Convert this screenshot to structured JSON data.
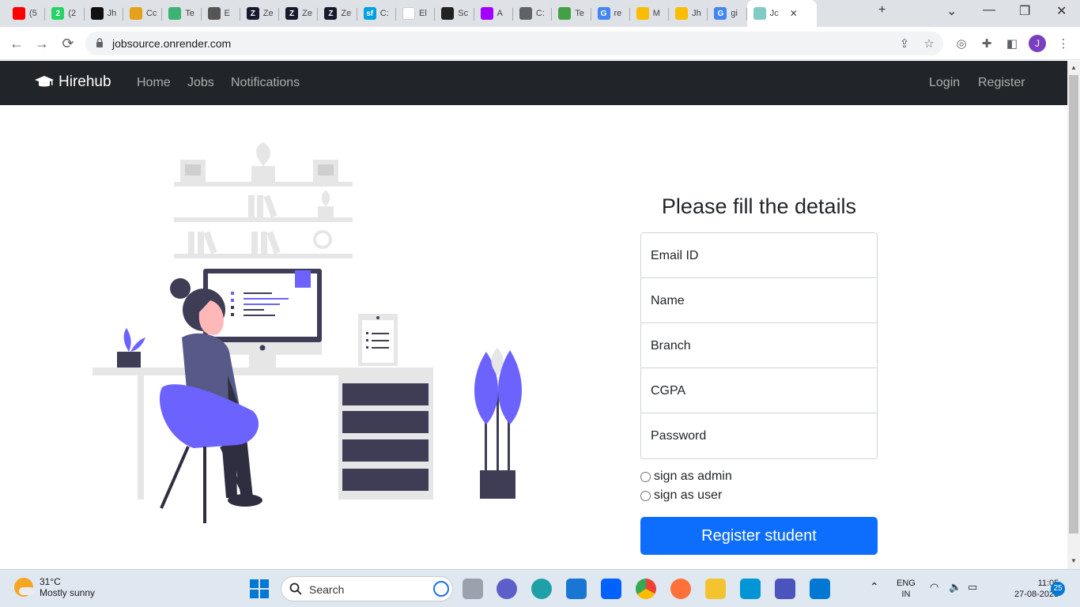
{
  "browser": {
    "tabs": [
      {
        "icon": "youtube-icon",
        "label": "(5",
        "color": "#ff0000"
      },
      {
        "icon": "whatsapp-icon",
        "label": "(2",
        "color": "#25d366",
        "glyph": "2"
      },
      {
        "icon": "github-icon",
        "label": "Jh",
        "color": "#111111"
      },
      {
        "icon": "codechef-icon",
        "label": "Cc",
        "color": "#e4a11b"
      },
      {
        "icon": "testgorilla-icon",
        "label": "Te",
        "color": "#3cb371"
      },
      {
        "icon": "ship-icon",
        "label": "E",
        "color": "#555555"
      },
      {
        "icon": "zepto-icon",
        "label": "Ze",
        "color": "#1a1a2e",
        "glyph": "Z"
      },
      {
        "icon": "zepto-icon",
        "label": "Ze",
        "color": "#1a1a2e",
        "glyph": "Z"
      },
      {
        "icon": "zepto-icon",
        "label": "Ze",
        "color": "#1a1a2e",
        "glyph": "Z"
      },
      {
        "icon": "salesforce-icon",
        "label": "C:",
        "color": "#00a1e0",
        "glyph": "sf"
      },
      {
        "icon": "blank-page-icon",
        "label": "El",
        "color": "#ffffff"
      },
      {
        "icon": "stack-icon",
        "label": "Sc",
        "color": "#222222"
      },
      {
        "icon": "arrow-icon",
        "label": "A",
        "color": "#a100ff"
      },
      {
        "icon": "globe-icon",
        "label": "C:",
        "color": "#5f6368"
      },
      {
        "icon": "leaf-icon",
        "label": "Te",
        "color": "#43a047"
      },
      {
        "icon": "google-icon",
        "label": "re",
        "color": "#4285f4",
        "glyph": "G"
      },
      {
        "icon": "drive-icon",
        "label": "M",
        "color": "#fbbc04"
      },
      {
        "icon": "drive-icon",
        "label": "Jh",
        "color": "#fbbc04"
      },
      {
        "icon": "google-icon",
        "label": "gi",
        "color": "#4285f4",
        "glyph": "G"
      },
      {
        "icon": "frame-icon",
        "label": "Jc",
        "color": "#80cbc4"
      }
    ],
    "url": "jobsource.onrender.com",
    "avatar_letter": "J"
  },
  "site": {
    "brand": "Hirehub",
    "nav_left": [
      "Home",
      "Jobs",
      "Notifications"
    ],
    "nav_right": [
      "Login",
      "Register"
    ]
  },
  "form": {
    "title": "Please fill the details",
    "fields": [
      {
        "placeholder": "Email ID"
      },
      {
        "placeholder": "Name"
      },
      {
        "placeholder": "Branch"
      },
      {
        "placeholder": "CGPA"
      },
      {
        "placeholder": "Password"
      }
    ],
    "radios": [
      "sign as admin",
      "sign as user"
    ],
    "submit": "Register student",
    "accent": "#0d6efd"
  },
  "taskbar": {
    "temperature": "31°C",
    "weather": "Mostly sunny",
    "search": "Search",
    "lang": "ENG",
    "region": "IN",
    "time": "11:05",
    "date": "27-08-2023",
    "notifications": "25"
  }
}
